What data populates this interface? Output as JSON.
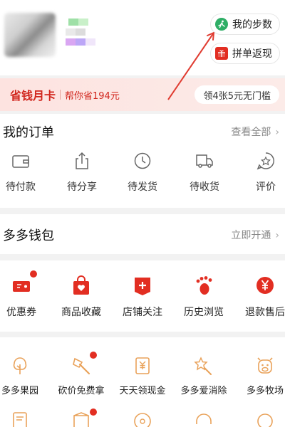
{
  "header": {
    "steps_button": {
      "label": "我的步数",
      "icon": "runner-icon"
    },
    "group_button": {
      "label": "拼单返现",
      "icon": "gift-icon"
    }
  },
  "month_card": {
    "title": "省钱月卡",
    "subtitle": "帮你省194元",
    "coupon": "领4张5元无门槛"
  },
  "orders": {
    "title": "我的订单",
    "view_all": "查看全部",
    "items": [
      {
        "label": "待付款",
        "icon": "wallet-icon"
      },
      {
        "label": "待分享",
        "icon": "share-icon"
      },
      {
        "label": "待发货",
        "icon": "clock-icon"
      },
      {
        "label": "待收货",
        "icon": "truck-icon"
      },
      {
        "label": "评价",
        "icon": "review-icon"
      }
    ]
  },
  "wallet": {
    "title": "多多钱包",
    "action": "立即开通"
  },
  "services": {
    "items": [
      {
        "label": "优惠券",
        "icon": "coupon-icon",
        "badge": true
      },
      {
        "label": "商品收藏",
        "icon": "bag-heart-icon",
        "badge": false
      },
      {
        "label": "店铺关注",
        "icon": "store-plus-icon",
        "badge": false
      },
      {
        "label": "历史浏览",
        "icon": "footprint-icon",
        "badge": false
      },
      {
        "label": "退款售后",
        "icon": "refund-yen-icon",
        "badge": false
      }
    ]
  },
  "more_services": {
    "items": [
      {
        "label": "多多果园",
        "icon": "tree-icon"
      },
      {
        "label": "砍价免费拿",
        "icon": "axe-icon"
      },
      {
        "label": "天天领现金",
        "icon": "yen-scroll-icon"
      },
      {
        "label": "多多爱消除",
        "icon": "star-wand-icon"
      },
      {
        "label": "多多牧场",
        "icon": "cow-icon"
      }
    ]
  },
  "colors": {
    "brand_red": "#e22e22",
    "accent_orange": "#e9a25a",
    "steps_green": "#2fae66"
  }
}
